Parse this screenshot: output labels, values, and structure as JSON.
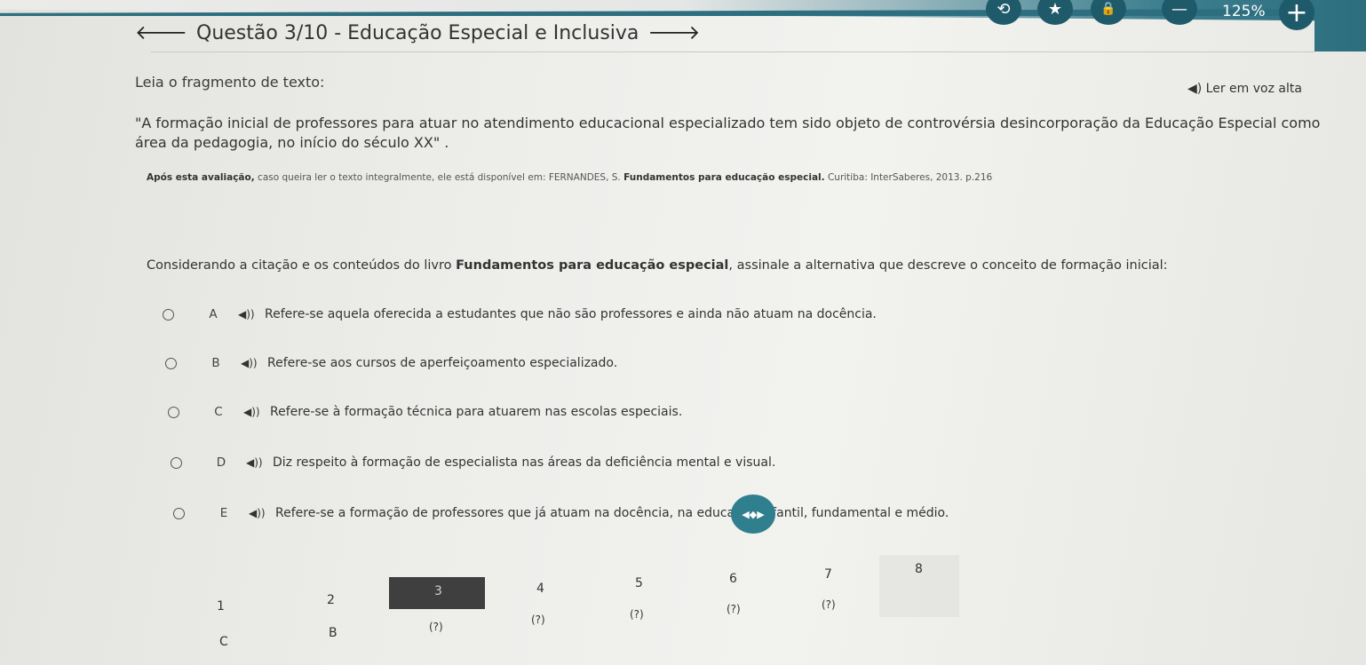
{
  "window": {
    "zoom_level": "125%",
    "accent_color": "#2c6d7e",
    "controls": [
      {
        "name": "refresh-icon",
        "glyph": "⟲"
      },
      {
        "name": "star-icon",
        "glyph": "★"
      },
      {
        "name": "lock-icon",
        "glyph": "🔒"
      },
      {
        "name": "minus-icon",
        "glyph": "—"
      }
    ],
    "plus_glyph": "+"
  },
  "header": {
    "back_glyph": "🡐",
    "title": "Questão 3/10 - Educação Especial e Inclusiva",
    "forward_glyph": "🡒"
  },
  "content": {
    "read_label": "Leia o fragmento de texto:",
    "read_aloud": "◀) Ler em voz alta",
    "quote": "\"A formação inicial de professores para atuar no atendimento educacional especializado tem sido objeto de controvérsia desincorporação da Educação Especial como área da pedagogia, no início do século XX\" .",
    "source_bold": "Após esta avaliação,",
    "source_text": " caso queira ler o texto integralmente, ele está disponível em: FERNANDES, S. ",
    "source_book": "Fundamentos para educação especial.",
    "source_tail": " Curitiba: InterSaberes, 2013. p.216",
    "question_pre": "Considerando a citação e os conteúdos do livro ",
    "question_book": "Fundamentos para educação especial",
    "question_post": ", assinale a alternativa que descreve o conceito de formação inicial:"
  },
  "options": [
    {
      "letter": "A",
      "text": "Refere-se aquela oferecida a estudantes que não são professores e ainda não atuam na docência."
    },
    {
      "letter": "B",
      "text": "Refere-se aos cursos de aperfeiçoamento especializado."
    },
    {
      "letter": "C",
      "text": "Refere-se à formação técnica para atuarem nas escolas especiais."
    },
    {
      "letter": "D",
      "text": "Diz respeito à formação de especialista nas áreas da deficiência mental e visual."
    },
    {
      "letter": "E",
      "text": "Refere-se a formação de professores que já atuam na docência, na educação infantil, fundamental e médio."
    }
  ],
  "speaker_glyph": "◀))",
  "nav_glyph": "◀◆▶",
  "pager": {
    "numbers": [
      "1",
      "2",
      "3",
      "4",
      "5",
      "6",
      "7",
      "8"
    ],
    "statuses": [
      "C",
      "B",
      "",
      "(?)",
      "(?)",
      "(?)",
      "(?)",
      "(?)"
    ],
    "current": "3"
  }
}
